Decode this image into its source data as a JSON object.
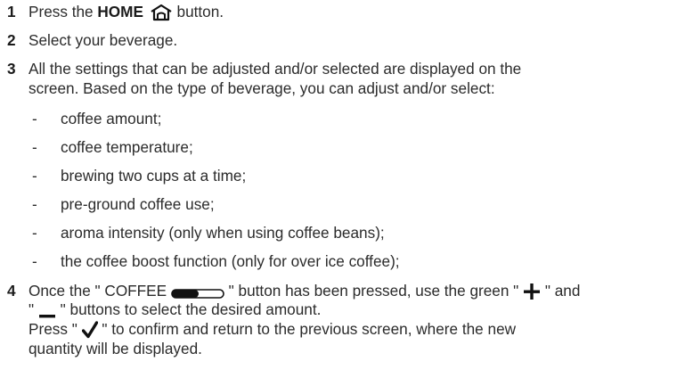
{
  "steps": [
    {
      "number": "1",
      "prefix": "Press the ",
      "bold": "HOME",
      "icon": "home-icon",
      "suffix": " button."
    },
    {
      "number": "2",
      "text": "Select your beverage."
    },
    {
      "number": "3",
      "line1": "All the settings that can be adjusted and/or selected are displayed on the",
      "line2": "screen. Based on the type of beverage, you can adjust and/or select:"
    },
    {
      "number": "4",
      "line1_prefix": "Once the \" COFFEE ",
      "line1_icon": "coffee-amount-bar-icon",
      "line1_mid": " \" button has been pressed, use the green \" ",
      "line1_plus_icon": "plus-icon",
      "line1_suffix": " \" and",
      "line2_prefix": "\" ",
      "line2_minus_icon": "minus-icon",
      "line2_suffix": " \" buttons to select the desired amount.",
      "line3_prefix": "Press \" ",
      "line3_check_icon": "check-icon",
      "line3_suffix": " \" to confirm and return to the previous screen, where the new",
      "line4": "quantity will be displayed."
    }
  ],
  "bullets": [
    "coffee amount;",
    "coffee temperature;",
    "brewing two cups at a time;",
    "pre-ground coffee use;",
    "aroma intensity (only when using coffee beans);",
    "the coffee boost function (only for over ice coffee);"
  ],
  "dash": "-",
  "colors": {
    "text": "#2b2b2b",
    "icon": "#111111"
  }
}
